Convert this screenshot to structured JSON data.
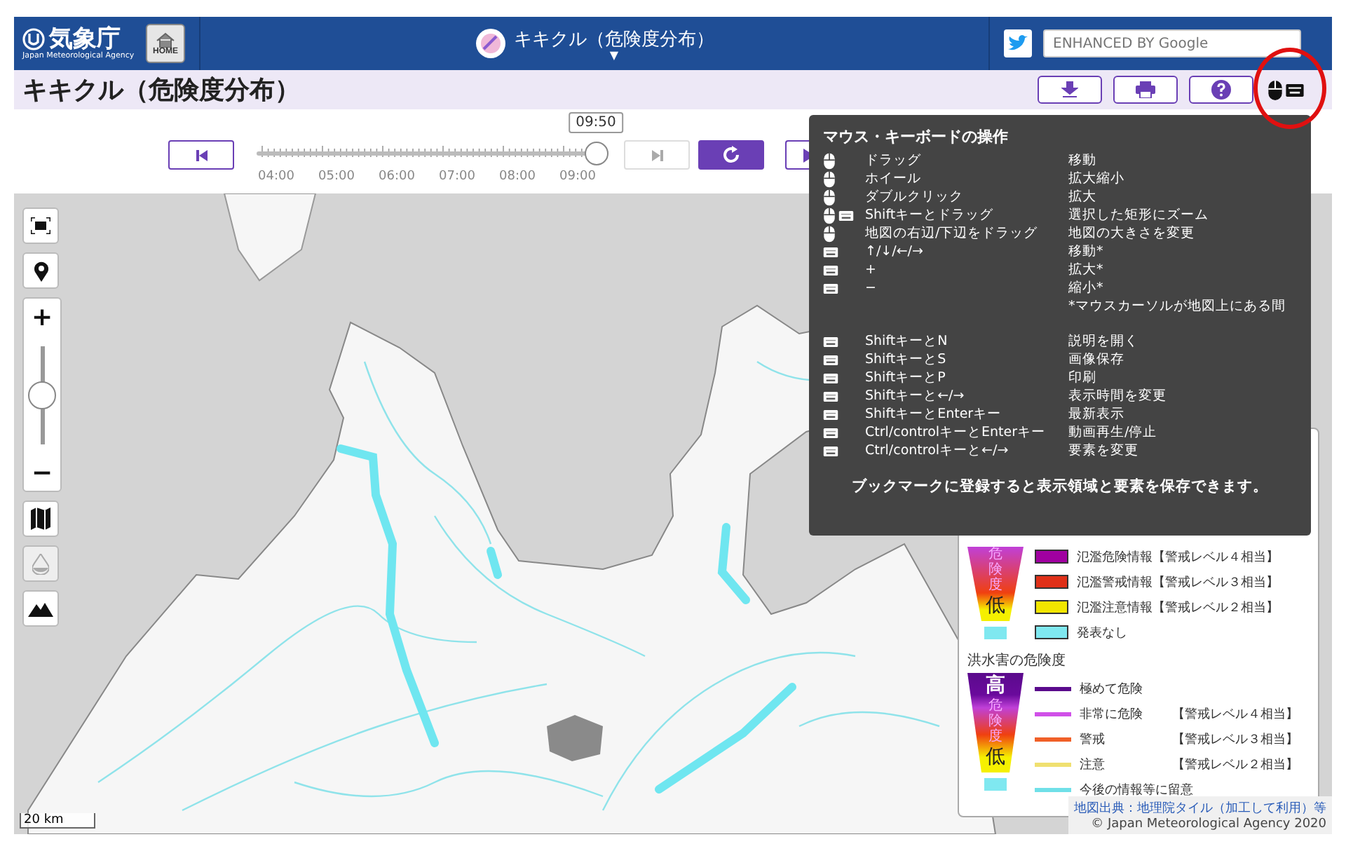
{
  "header": {
    "logo_text": "気象庁",
    "logo_subtext": "Japan Meteorological Agency",
    "home_label": "HOME",
    "app_title": "キキクル（危険度分布）",
    "app_caret": "▼",
    "search": {
      "placeholder": "ENHANCED BY Google"
    }
  },
  "title_bar": {
    "title": "キキクル（危険度分布）"
  },
  "timeline": {
    "current_time": "09:50",
    "level": 1,
    "next_disabled": true,
    "ticks": [
      "04:00",
      "05:00",
      "06:00",
      "07:00",
      "08:00",
      "09:00"
    ]
  },
  "map_controls": {
    "zoom": {
      "level": 0.5,
      "in_label": "+",
      "out_label": "−"
    },
    "layers": [
      {
        "kind": "map",
        "disabled": false
      },
      {
        "kind": "drop",
        "disabled": true
      },
      {
        "kind": "mountain",
        "disabled": false
      }
    ]
  },
  "help_popup": {
    "title": "マウス・キーボードの操作",
    "groups": [
      {
        "rows": [
          {
            "kind": "mouse",
            "keys": "ドラッグ",
            "action": "移動"
          },
          {
            "kind": "mouse",
            "keys": "ホイール",
            "action": "拡大縮小"
          },
          {
            "kind": "mouse",
            "keys": "ダブルクリック",
            "action": "拡大"
          },
          {
            "kind": "mouse_keyboard",
            "keys": "Shiftキーとドラッグ",
            "action": "選択した矩形にズーム"
          },
          {
            "kind": "mouse",
            "keys": "地図の右辺/下辺をドラッグ",
            "action": "地図の大きさを変更"
          },
          {
            "kind": "keyboard",
            "keys": "↑/↓/←/→",
            "action": "移動*"
          },
          {
            "kind": "keyboard",
            "keys": "+",
            "action": "拡大*"
          },
          {
            "kind": "keyboard",
            "keys": "−",
            "action": "縮小*"
          }
        ],
        "note": "*マウスカーソルが地図上にある間"
      },
      {
        "rows": [
          {
            "kind": "keyboard",
            "keys": "ShiftキーとN",
            "action": "説明を開く"
          },
          {
            "kind": "keyboard",
            "keys": "ShiftキーとS",
            "action": "画像保存"
          },
          {
            "kind": "keyboard",
            "keys": "ShiftキーとP",
            "action": "印刷"
          },
          {
            "kind": "keyboard",
            "keys": "Shiftキーと←/→",
            "action": "表示時間を変更"
          },
          {
            "kind": "keyboard",
            "keys": "ShiftキーとEnterキー",
            "action": "最新表示"
          },
          {
            "kind": "keyboard",
            "keys": "Ctrl/controlキーとEnterキー",
            "action": "動画再生/停止"
          },
          {
            "kind": "keyboard",
            "keys": "Ctrl/controlキーと←/→",
            "action": "要素を変更"
          }
        ]
      }
    ],
    "footer": "ブックマークに登録すると表示領域と要素を保存できます。"
  },
  "legend": {
    "sections": [
      {
        "scale": {
          "middle": "危険度",
          "low": "低"
        },
        "items": [
          {
            "kind": "box",
            "label": "氾濫危険情報【警戒レベル４相当】",
            "color": "#a000a0"
          },
          {
            "kind": "box",
            "label": "氾濫警戒情報【警戒レベル３相当】",
            "color": "#e03018"
          },
          {
            "kind": "box",
            "label": "氾濫注意情報【警戒レベル２相当】",
            "color": "#f2e600"
          },
          {
            "kind": "box",
            "label": "発表なし",
            "color": "#7fe8f0"
          }
        ]
      },
      {
        "title": "洪水害の危険度",
        "scale": {
          "high": "高",
          "middle": "危険度",
          "low": "低"
        },
        "items": [
          {
            "kind": "line",
            "label": "極めて危険",
            "color": "#5a0a8c"
          },
          {
            "kind": "line",
            "label": "非常に危険",
            "note": "【警戒レベル４相当】",
            "color": "#d050e8"
          },
          {
            "kind": "line",
            "label": "警戒",
            "note": "【警戒レベル３相当】",
            "color": "#f06028"
          },
          {
            "kind": "line",
            "label": "注意",
            "note": "【警戒レベル２相当】",
            "color": "#f0e070"
          },
          {
            "kind": "line",
            "label": "今後の情報等に留意",
            "color": "#70e0e8"
          }
        ]
      }
    ]
  },
  "map": {
    "scale": "20 km",
    "attribution_link": "地図出典：地理院タイル（加工して利用）等",
    "copyright": "© Japan Meteorological Agency 2020"
  }
}
